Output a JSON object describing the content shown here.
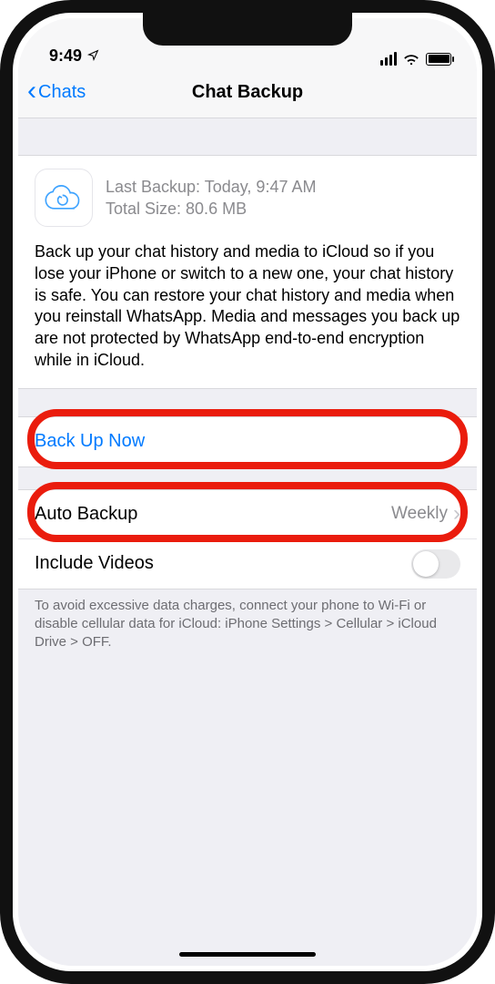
{
  "status": {
    "time": "9:49",
    "location_icon": "◤"
  },
  "nav": {
    "back_label": "Chats",
    "title": "Chat Backup"
  },
  "backup_info": {
    "last_backup_label": "Last Backup: Today, 9:47 AM",
    "total_size_label": "Total Size: 80.6 MB",
    "description": "Back up your chat history and media to iCloud so if you lose your iPhone or switch to a new one, your chat history is safe. You can restore your chat history and media when you reinstall WhatsApp. Media and messages you back up are not protected by WhatsApp end-to-end encryption while in iCloud."
  },
  "rows": {
    "back_up_now": "Back Up Now",
    "auto_backup_label": "Auto Backup",
    "auto_backup_value": "Weekly",
    "include_videos_label": "Include Videos"
  },
  "footer": "To avoid excessive data charges, connect your phone to Wi-Fi or disable cellular data for iCloud: iPhone Settings > Cellular > iCloud Drive > OFF.",
  "colors": {
    "accent": "#007aff",
    "highlight": "#ea1c0d"
  }
}
